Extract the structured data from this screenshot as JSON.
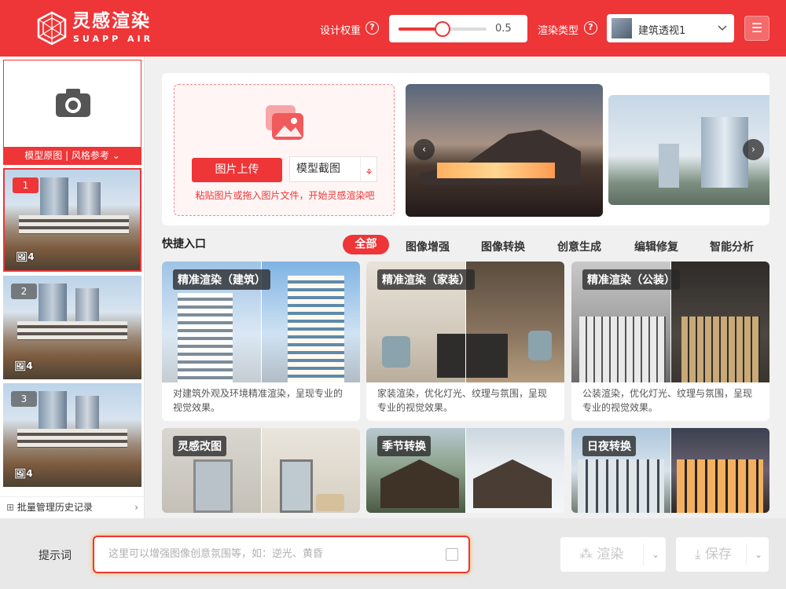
{
  "header": {
    "brand": "灵感渲染",
    "brand_sub": "SUAPP AIR",
    "weight_label": "设计权重",
    "weight_value": "0.5",
    "weight_level": 0.5,
    "render_type_label": "渲染类型",
    "render_type_value": "建筑透视1",
    "accent": "#ee3537"
  },
  "sidebar": {
    "reference_label": "模型原图 | 风格参考",
    "history": [
      {
        "index": "1",
        "count": "4"
      },
      {
        "index": "2",
        "count": "4"
      },
      {
        "index": "3",
        "count": "4"
      }
    ],
    "batch_label": "批量管理历史记录"
  },
  "upload": {
    "upload_button": "图片上传",
    "screenshot_button": "模型截图",
    "hint": "粘贴图片或拖入图片文件，开始灵感渲染吧"
  },
  "quick": {
    "title": "快捷入口",
    "tabs": [
      "全部",
      "图像增强",
      "图像转换",
      "创意生成",
      "编辑修复",
      "智能分析"
    ],
    "cards": [
      {
        "title": "精准渲染（建筑）",
        "desc": "对建筑外观及环境精准渲染，呈现专业的视觉效果。"
      },
      {
        "title": "精准渲染（家装）",
        "desc": "家装渲染，优化灯光、纹理与氛围，呈现专业的视觉效果。"
      },
      {
        "title": "精准渲染（公装）",
        "desc": "公装渲染，优化灯光、纹理与氛围，呈现专业的视觉效果。"
      },
      {
        "title": "灵感改图",
        "desc": ""
      },
      {
        "title": "季节转换",
        "desc": ""
      },
      {
        "title": "日夜转换",
        "desc": ""
      }
    ]
  },
  "bottom": {
    "prompt_label": "提示词",
    "prompt_placeholder": "这里可以增强图像创意氛围等，如：逆光、黄昏",
    "render_button": "渲染",
    "save_button": "保存"
  }
}
